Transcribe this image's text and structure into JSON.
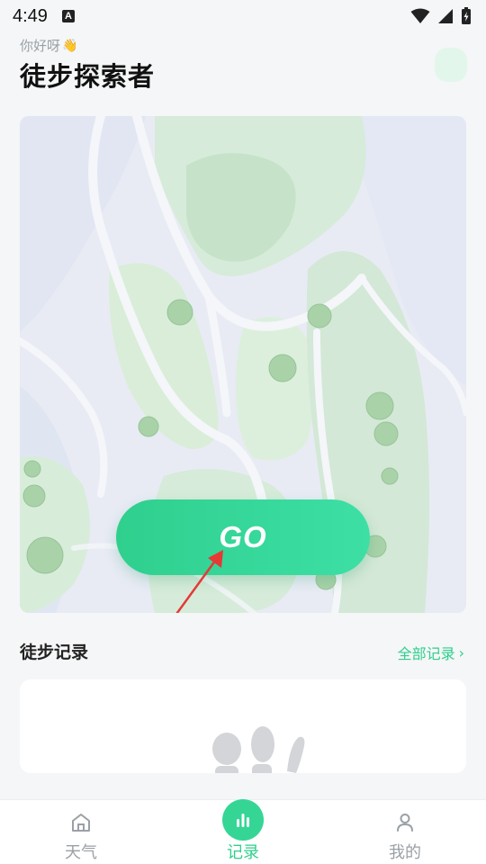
{
  "status_bar": {
    "time": "4:49",
    "notification_letter": "A"
  },
  "header": {
    "greeting": "你好呀",
    "greeting_emoji": "👋",
    "title": "徒步探索者"
  },
  "map_card": {
    "go_label": "GO"
  },
  "records": {
    "section_title": "徒步记录",
    "all_records_label": "全部记录",
    "all_records_chevron": "›"
  },
  "bottom_nav": {
    "items": [
      {
        "label": "天气",
        "icon": "home-icon"
      },
      {
        "label": "记录",
        "icon": "chart-icon"
      },
      {
        "label": "我的",
        "icon": "person-icon"
      }
    ],
    "active_index": 1
  },
  "colors": {
    "accent": "#2fcf8e",
    "arrow": "#e53935"
  }
}
